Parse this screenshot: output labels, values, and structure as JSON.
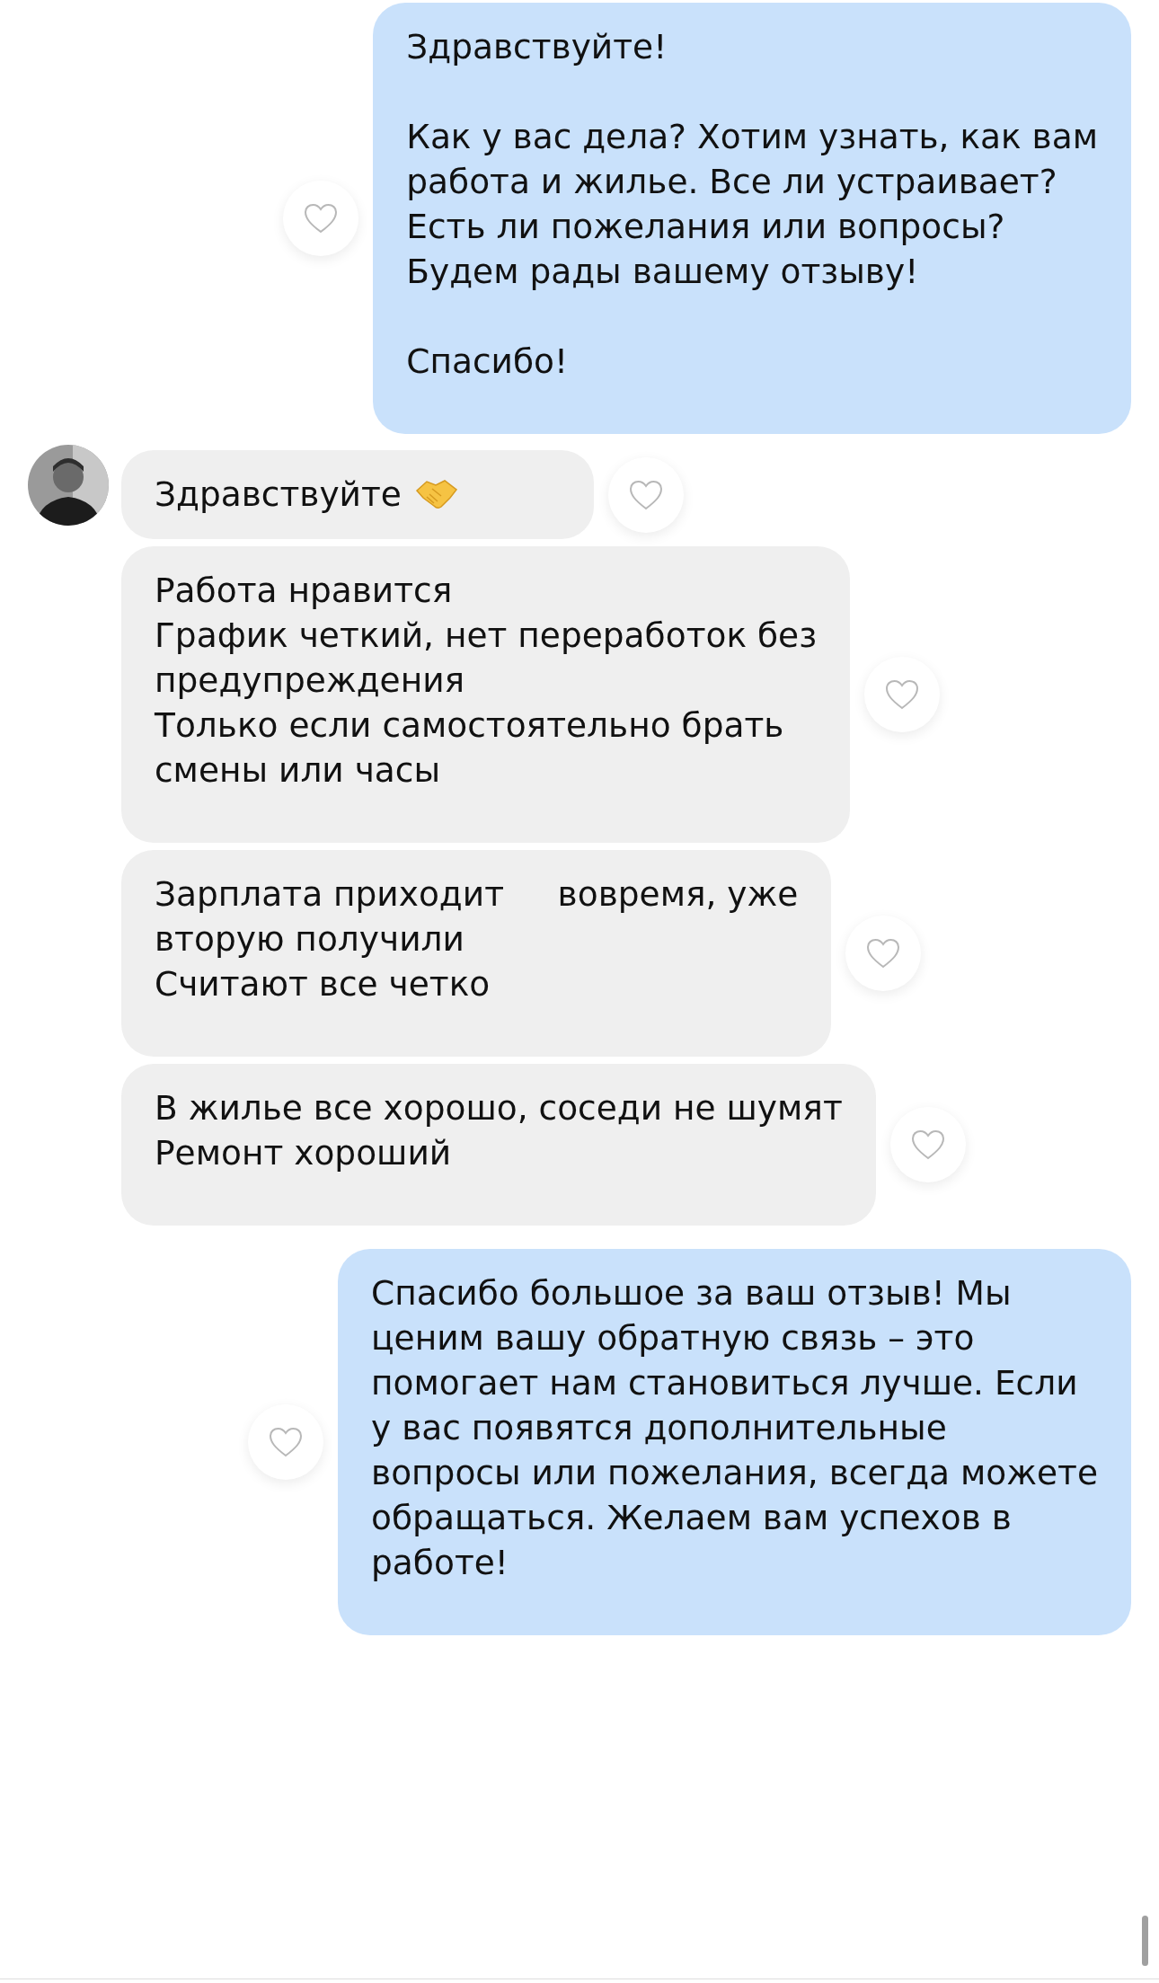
{
  "messages": [
    {
      "kind": "outgoing",
      "text": "Здравствуйте!\n\nКак у вас дела? Хотим узнать, как вам\nработа и жилье. Все ли устраивает?\nЕсть ли пожелания или вопросы?\nБудем рады вашему отзыву!\n\nСпасибо!",
      "liked": false
    },
    {
      "kind": "incoming",
      "text": "Здравствуйте",
      "emoji": true,
      "liked": false
    },
    {
      "kind": "incoming",
      "text": "Работа нравится\nГрафик четкий, нет переработок без\nпредупреждения\nТолько если самостоятельно брать\nсмены или часы",
      "liked": false
    },
    {
      "kind": "incoming",
      "text": "Зарплата приходит     вовремя, уже\nвторую получили\nСчитают все четко",
      "liked": false
    },
    {
      "kind": "incoming",
      "text": "В жилье все хорошо, соседи не шумят\nРемонт хороший",
      "liked": false
    },
    {
      "kind": "outgoing",
      "text": "Спасибо большое за ваш отзыв! Мы\nценим вашу обратную связь – это\nпомогает нам становиться лучше. Если\nу вас появятся дополнительные\nвопросы или пожелания, всегда можете\nобращаться. Желаем вам успехов в\nработе!",
      "liked": false
    }
  ]
}
